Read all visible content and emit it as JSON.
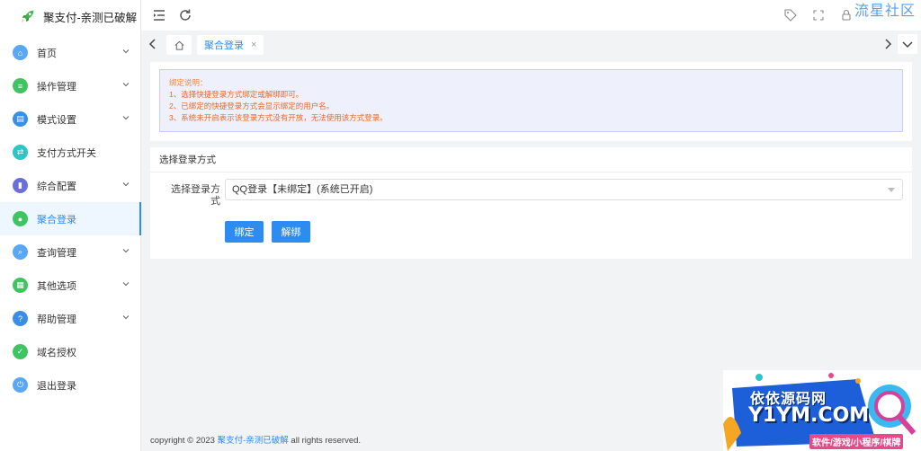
{
  "app": {
    "title": "聚支付-亲测已破解"
  },
  "sidebar": {
    "items": [
      {
        "label": "首页",
        "icon": "home-icon",
        "color": "#5aa7f5",
        "has_arrow": true,
        "active": false
      },
      {
        "label": "操作管理",
        "icon": "sliders-icon",
        "color": "#40c463",
        "has_arrow": true,
        "active": false
      },
      {
        "label": "模式设置",
        "icon": "layout-icon",
        "color": "#3a8ee6",
        "has_arrow": true,
        "active": false
      },
      {
        "label": "支付方式开关",
        "icon": "toggle-icon",
        "color": "#2ec5c7",
        "has_arrow": false,
        "active": false
      },
      {
        "label": "综合配置",
        "icon": "book-icon",
        "color": "#6b6fd8",
        "has_arrow": true,
        "active": false
      },
      {
        "label": "聚合登录",
        "icon": "login-icon",
        "color": "#40c463",
        "has_arrow": false,
        "active": true
      },
      {
        "label": "查询管理",
        "icon": "search-icon",
        "color": "#5aa7f5",
        "has_arrow": true,
        "active": false
      },
      {
        "label": "其他选项",
        "icon": "grid-icon",
        "color": "#40c463",
        "has_arrow": true,
        "active": false
      },
      {
        "label": "帮助管理",
        "icon": "help-icon",
        "color": "#3a8ee6",
        "has_arrow": true,
        "active": false
      },
      {
        "label": "域名授权",
        "icon": "shield-icon",
        "color": "#40c463",
        "has_arrow": false,
        "active": false
      },
      {
        "label": "退出登录",
        "icon": "power-icon",
        "color": "#5aa7f5",
        "has_arrow": false,
        "active": false
      }
    ]
  },
  "header": {
    "watermark": "流星社区"
  },
  "tabs": {
    "active_label": "聚合登录",
    "close_glyph": "×"
  },
  "notice": {
    "title": "绑定说明：",
    "lines": [
      "1、选择快捷登录方式绑定或解绑即可。",
      "2、已绑定的快捷登录方式会显示绑定的用户名。",
      "3、系统未开启表示该登录方式没有开放，无法使用该方式登录。"
    ]
  },
  "form": {
    "section_title": "选择登录方式",
    "field_label": "选择登录方式",
    "select_value": "QQ登录【未绑定】(系统已开启)",
    "bind_label": "绑定",
    "unbind_label": "解绑"
  },
  "footer": {
    "prefix": "copyright © 2023 ",
    "brand": "聚支付-亲测已破解",
    "suffix": " all rights reserved."
  },
  "badge": {
    "line1": "依依源码网",
    "line2": "Y1YM.COM",
    "line3": "软件/游戏/小程序/棋牌"
  },
  "colors": {
    "primary": "#2d8cf0",
    "notice_text": "#e8692c",
    "notice_bg": "#eef0fc"
  }
}
